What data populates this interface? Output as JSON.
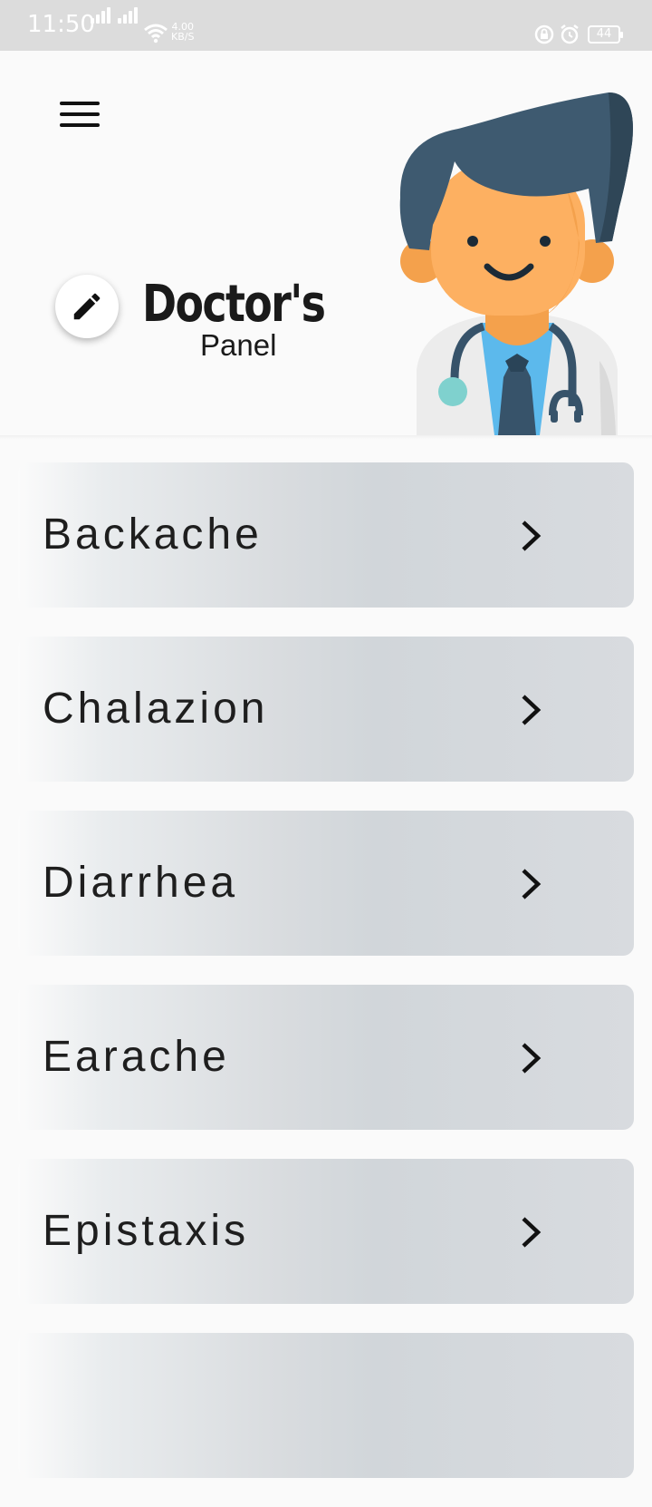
{
  "status_bar": {
    "time": "11:50",
    "net_speed_value": "4.00",
    "net_speed_unit": "KB/S",
    "battery": "44"
  },
  "header": {
    "title": "Doctor's",
    "subtitle": "Panel",
    "menu_icon": "hamburger-menu-icon",
    "edit_icon": "pencil-icon",
    "illustration": "doctor-avatar"
  },
  "items": [
    {
      "label": "Backache"
    },
    {
      "label": "Chalazion"
    },
    {
      "label": "Diarrhea"
    },
    {
      "label": "Earache"
    },
    {
      "label": "Epistaxis"
    },
    {
      "label": ""
    }
  ],
  "colors": {
    "background": "#fafafa",
    "status_bar": "#dcdcdc",
    "card_gradient_end": "#d3d8dc",
    "text": "#1e1e1e"
  }
}
